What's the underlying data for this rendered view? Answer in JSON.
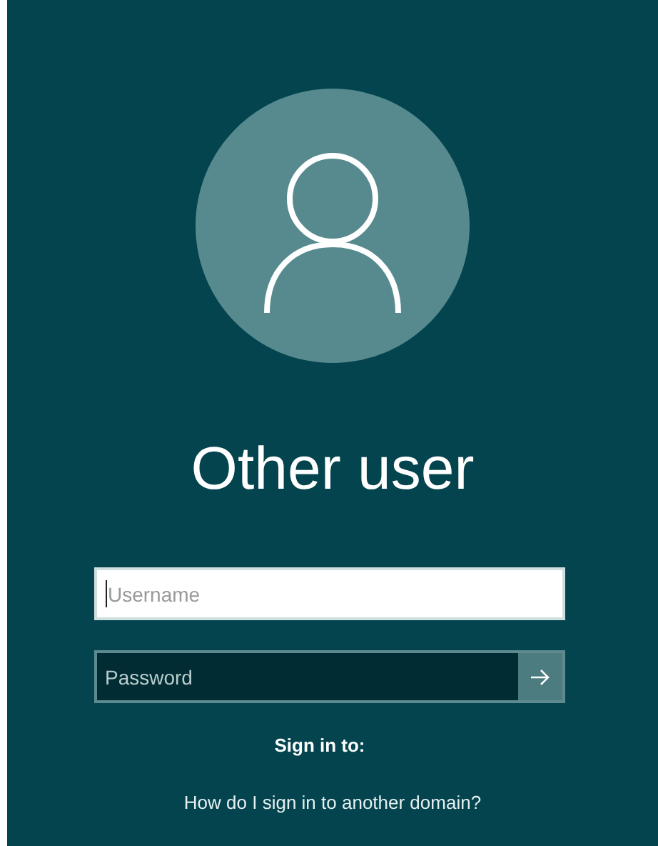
{
  "user": {
    "name": "Other user"
  },
  "username": {
    "placeholder": "Username",
    "focused": true
  },
  "password": {
    "placeholder": "Password"
  },
  "sign_in_to": {
    "label": "Sign in to:"
  },
  "help_link": {
    "text": "How do I sign in to another domain?"
  }
}
